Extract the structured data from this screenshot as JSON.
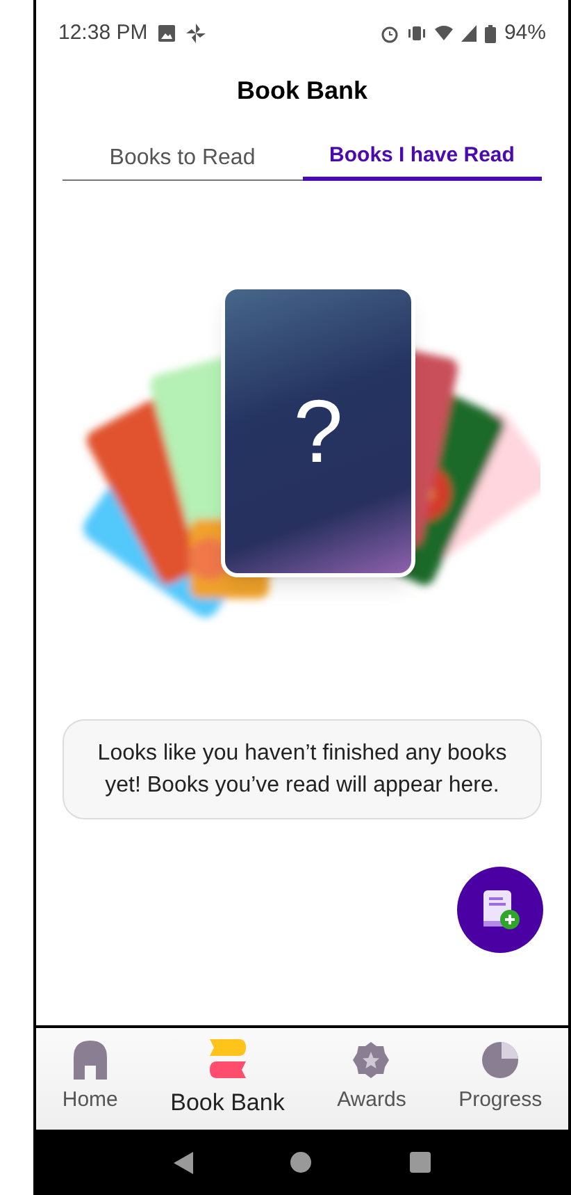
{
  "status_bar": {
    "time": "12:38 PM",
    "battery": "94%"
  },
  "header": {
    "title": "Book Bank"
  },
  "tabs": [
    {
      "label": "Books to Read",
      "selected": false
    },
    {
      "label": "Books I have Read",
      "selected": true
    }
  ],
  "empty_state": {
    "mystery_card": "?",
    "message": "Looks like you haven’t finished any books  yet! Books you’ve read will appear here."
  },
  "bottom_nav": [
    {
      "label": "Home",
      "kind": "home",
      "selected": false
    },
    {
      "label": "Book Bank",
      "kind": "books",
      "selected": true
    },
    {
      "label": "Awards",
      "kind": "awards",
      "selected": false
    },
    {
      "label": "Progress",
      "kind": "progress",
      "selected": false
    }
  ]
}
